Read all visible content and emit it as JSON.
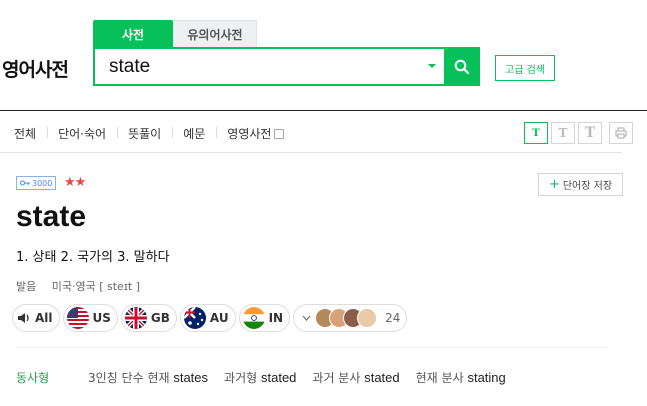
{
  "brand": {
    "title": "영어사전"
  },
  "tabs": [
    {
      "label": "사전",
      "active": true
    },
    {
      "label": "유의어사전",
      "active": false
    }
  ],
  "search": {
    "value": "state",
    "advanced_label": "고급 검색"
  },
  "filters": [
    "전체",
    "단어·숙어",
    "뜻풀이",
    "예문",
    "영영사전"
  ],
  "font_tools": [
    "T",
    "T",
    "T"
  ],
  "entry": {
    "level_badge": "3000",
    "stars": "★★",
    "save_label": "단어장 저장",
    "word": "state",
    "meanings": "1. 상태 2. 국가의 3. 말하다",
    "pron_label": "발음",
    "pron_value": "미국·영국 [ steɪt ]"
  },
  "audio": [
    {
      "label": "All",
      "icon": "speaker-icon"
    },
    {
      "label": "US",
      "icon": "us-flag-icon"
    },
    {
      "label": "GB",
      "icon": "gb-flag-icon"
    },
    {
      "label": "AU",
      "icon": "au-flag-icon"
    },
    {
      "label": "IN",
      "icon": "in-flag-icon"
    }
  ],
  "contributors": {
    "count": "24"
  },
  "conjugation": {
    "label": "동사형",
    "items": [
      {
        "name": "3인칭 단수 현재",
        "value": "states"
      },
      {
        "name": "과거형",
        "value": "stated"
      },
      {
        "name": "과거 분사",
        "value": "stated"
      },
      {
        "name": "현재 분사",
        "value": "stating"
      }
    ]
  },
  "colors": {
    "accent": "#08c05a",
    "star": "#e8484c",
    "badge": "#4a8ad8"
  }
}
